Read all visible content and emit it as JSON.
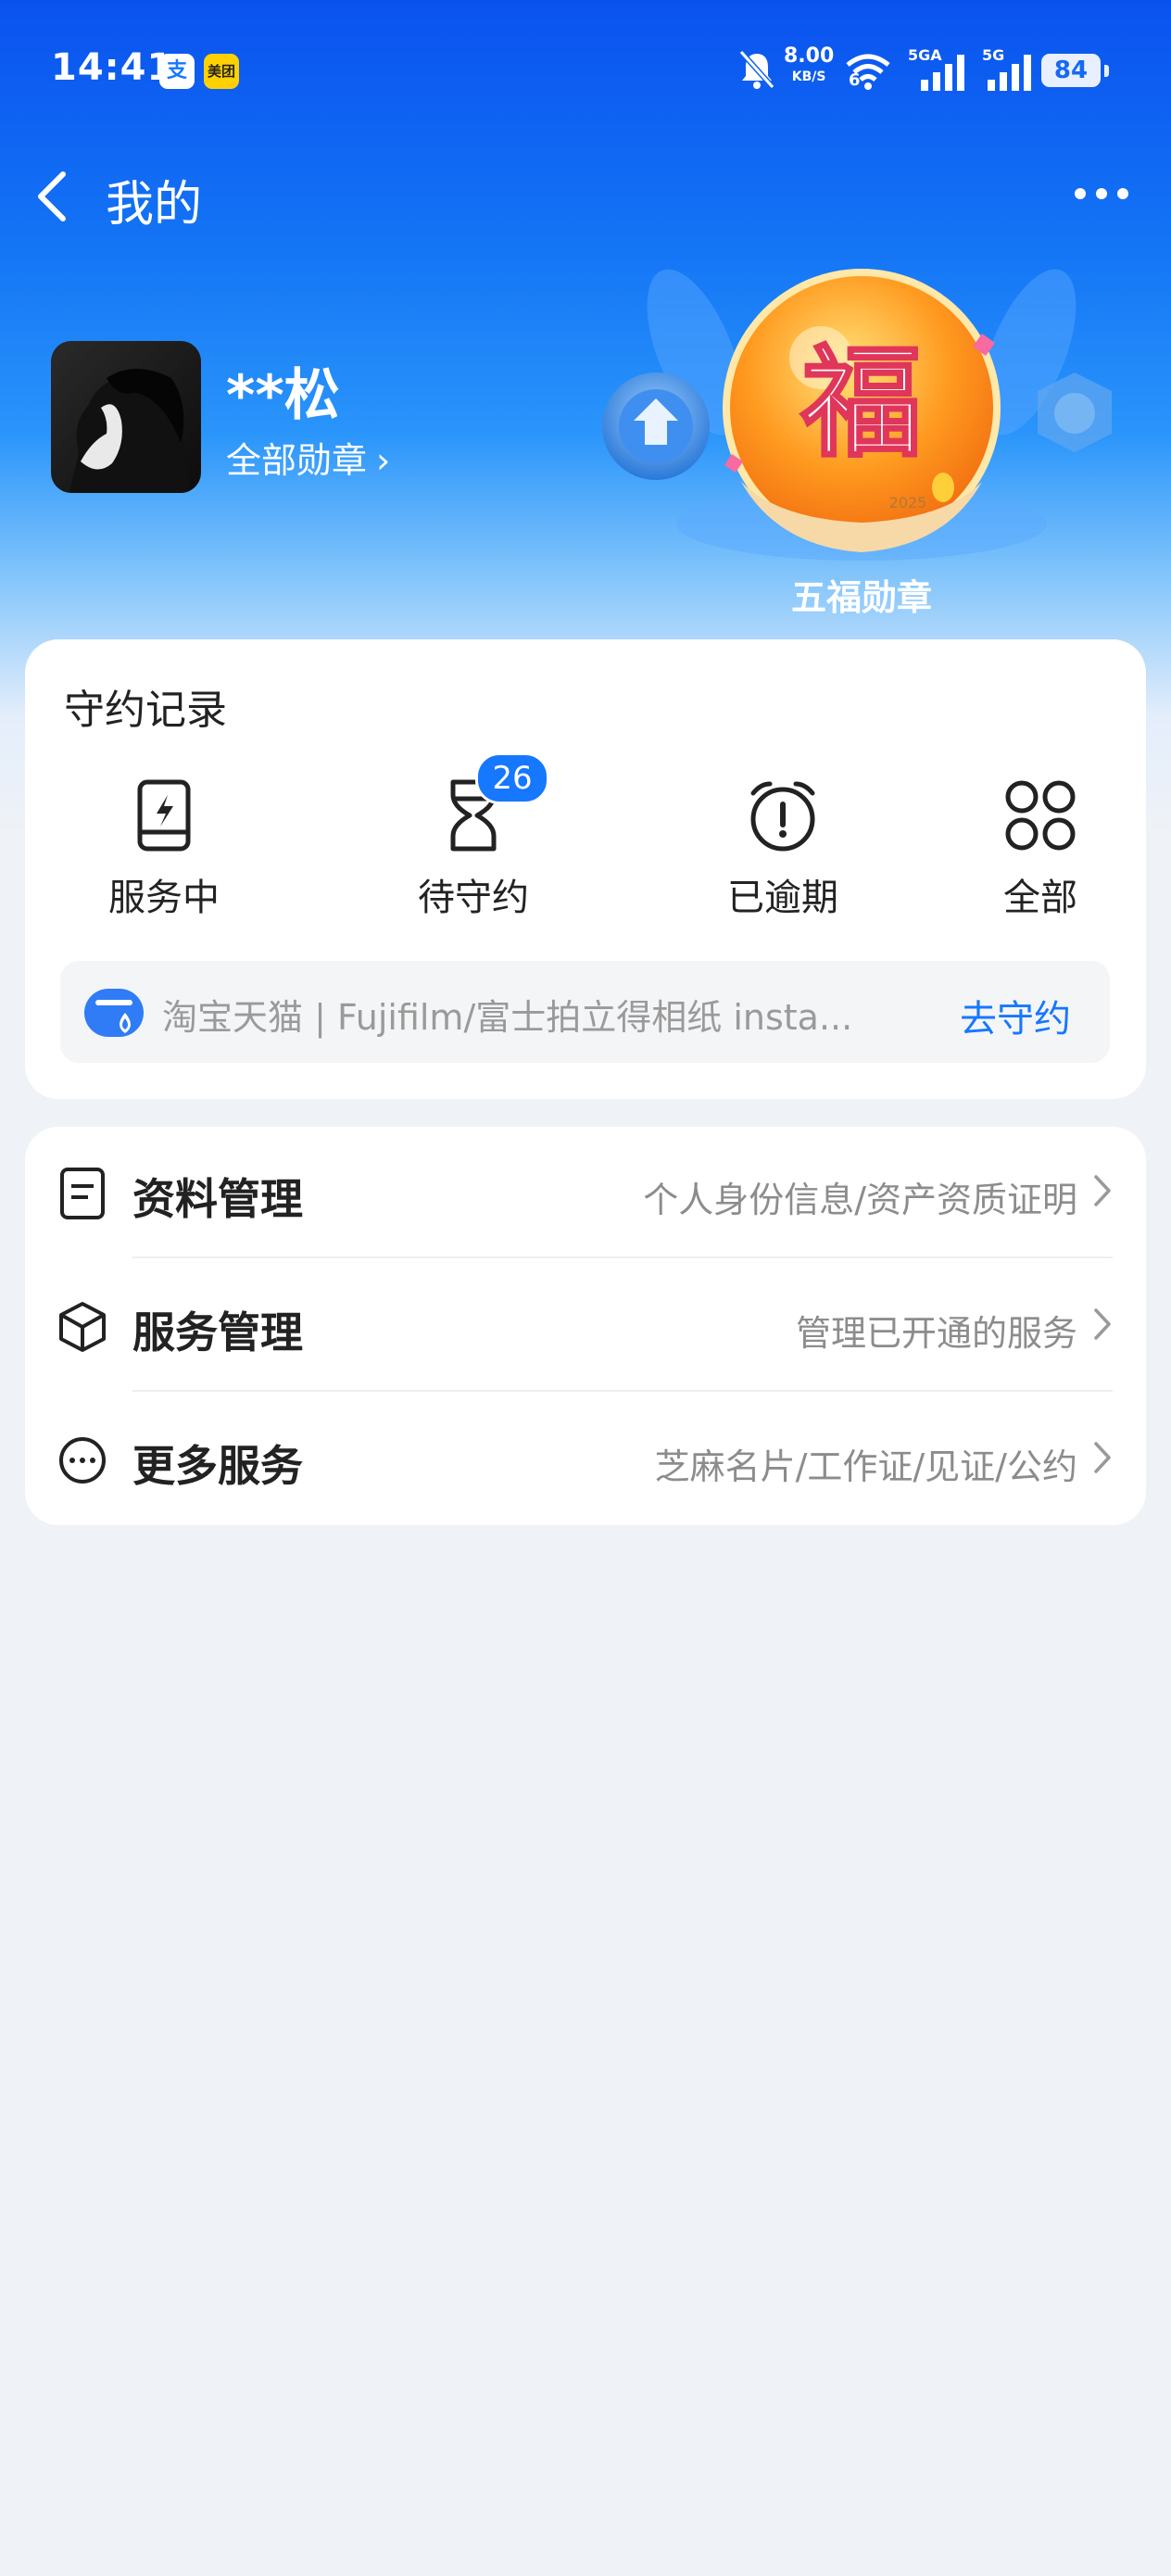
{
  "status_bar": {
    "time": "14:41",
    "app_icon_1": "支",
    "app_icon_2": "美团",
    "net_speed": "8.00",
    "net_speed_unit": "KB/S",
    "wifi_label": "6",
    "signal_1": "5GA",
    "signal_2": "5G",
    "battery": "84",
    "icons": [
      "alipay-notify-icon",
      "meituan-notify-icon",
      "mute-bell-icon",
      "wifi-icon",
      "signal-icon",
      "battery-icon"
    ]
  },
  "header": {
    "title": "我的",
    "back_icon": "chevron-left-icon",
    "more_icon": "more-dots-icon"
  },
  "profile": {
    "name": "**松",
    "badges_link": "全部勋章",
    "featured_medal": "五福勋章",
    "medal_glyph": "福",
    "medal_year": "2025"
  },
  "records": {
    "title": "守约记录",
    "items": [
      {
        "label": "服务中",
        "icon": "lightning-card-icon"
      },
      {
        "label": "待守约",
        "icon": "hourglass-icon",
        "badge": "26"
      },
      {
        "label": "已逾期",
        "icon": "alarm-clock-icon"
      },
      {
        "label": "全部",
        "icon": "grid-icon"
      }
    ],
    "pending": {
      "text": "淘宝天猫 | Fujifilm/富士拍立得相纸 insta...",
      "action": "去守约"
    }
  },
  "menu": [
    {
      "title": "资料管理",
      "desc": "个人身份信息/资产资质证明",
      "icon": "document-icon"
    },
    {
      "title": "服务管理",
      "desc": "管理已开通的服务",
      "icon": "cube-icon"
    },
    {
      "title": "更多服务",
      "desc": "芝麻名片/工作证/见证/公约",
      "icon": "more-circle-icon"
    }
  ],
  "colors": {
    "brand_blue": "#1677ff",
    "hero_top": "#0a52ef",
    "page_bg": "#eff2f7"
  }
}
